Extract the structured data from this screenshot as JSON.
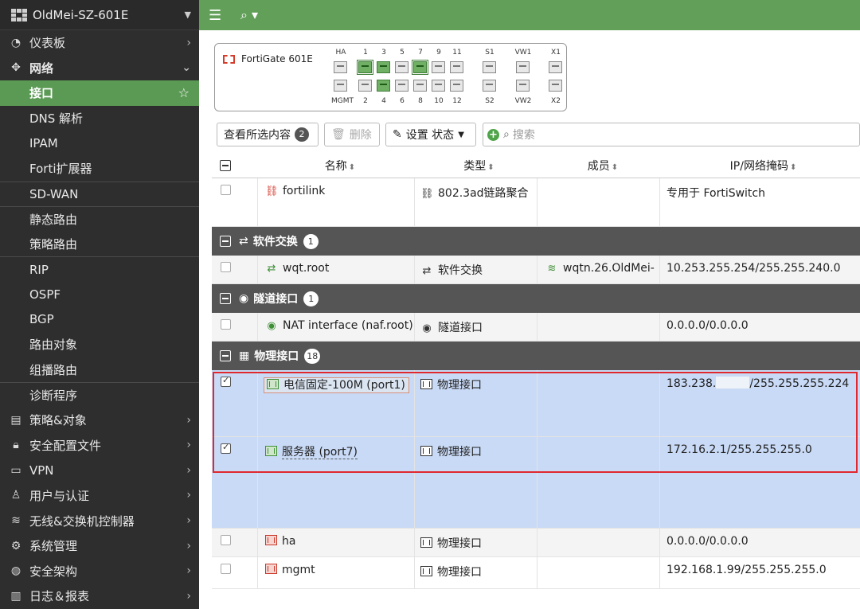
{
  "device_name": "OldMei-SZ-601E",
  "sidebar": {
    "items": [
      {
        "icon": "dashboard-icon",
        "glyph": "◔",
        "label": "仪表板",
        "chevron": "›"
      },
      {
        "icon": "network-icon",
        "glyph": "✥",
        "label": "网络",
        "chevron": "⌄"
      }
    ],
    "network_sub": [
      {
        "label": "接口"
      },
      {
        "label": "DNS 解析"
      },
      {
        "label": "IPAM"
      },
      {
        "label": "Forti扩展器"
      },
      {
        "label": "SD-WAN"
      },
      {
        "label": "静态路由"
      },
      {
        "label": "策略路由"
      },
      {
        "label": "RIP"
      },
      {
        "label": "OSPF"
      },
      {
        "label": "BGP"
      },
      {
        "label": "路由对象"
      },
      {
        "label": "组播路由"
      },
      {
        "label": "诊断程序"
      }
    ],
    "bottom_items": [
      {
        "icon": "policy-icon",
        "glyph": "▤",
        "label": "策略&对象"
      },
      {
        "icon": "lock-icon",
        "glyph": "🔒︎",
        "label": "安全配置文件"
      },
      {
        "icon": "laptop-icon",
        "glyph": "▭",
        "label": "VPN"
      },
      {
        "icon": "user-icon",
        "glyph": "♙",
        "label": "用户与认证"
      },
      {
        "icon": "wifi-icon",
        "glyph": "≋",
        "label": "无线&交换机控制器"
      },
      {
        "icon": "gear-icon",
        "glyph": "⚙",
        "label": "系统管理"
      },
      {
        "icon": "fabric-icon",
        "glyph": "◍",
        "label": "安全架构"
      },
      {
        "icon": "chart-icon",
        "glyph": "▥",
        "label": "日志＆报表"
      }
    ]
  },
  "topbar": {
    "menu_glyph": "☰",
    "search_glyph": "⌕ ▾"
  },
  "device_panel": {
    "model": "FortiGate 601E",
    "top_labels": [
      "HA",
      "1",
      "3",
      "5",
      "7",
      "9",
      "11",
      "S1",
      "VW1",
      "X1"
    ],
    "bottom_labels": [
      "MGMT",
      "2",
      "4",
      "6",
      "8",
      "10",
      "12",
      "S2",
      "VW2",
      "X2"
    ]
  },
  "toolbar": {
    "view_selected": "查看所选内容",
    "view_selected_count": "2",
    "delete": "删除",
    "set_status": "设置 状态",
    "search_placeholder": "搜索"
  },
  "columns": [
    "名称",
    "类型",
    "成员",
    "IP/网络掩码"
  ],
  "rows": {
    "fortilink": {
      "name": "fortilink",
      "type": "802.3ad链路聚合",
      "member": "",
      "ip": "专用于 FortiSwitch"
    },
    "wqt": {
      "name": "wqt.root",
      "type": "软件交换",
      "member": "wqtn.26.OldMei-",
      "ip": "10.253.255.254/255.255.240.0"
    },
    "naf": {
      "name": "NAT interface (naf.root)",
      "type": "隧道接口",
      "member": "",
      "ip": "0.0.0.0/0.0.0.0"
    },
    "port1": {
      "name": "电信固定-100M (port1)",
      "type": "物理接口",
      "member": "",
      "ip_prefix": "183.238.",
      "ip_suffix": "/255.255.255.224"
    },
    "port7": {
      "name": "服务器 (port7)",
      "type": "物理接口",
      "member": "",
      "ip": "172.16.2.1/255.255.255.0"
    },
    "ha": {
      "name": "ha",
      "type": "物理接口",
      "member": "",
      "ip": "0.0.0.0/0.0.0.0"
    },
    "mgmt": {
      "name": "mgmt",
      "type": "物理接口",
      "member": "",
      "ip": "192.168.1.99/255.255.255.0"
    }
  },
  "groups": {
    "software_switch": {
      "label": "软件交换",
      "count": "1"
    },
    "tunnel": {
      "label": "隧道接口",
      "count": "1"
    },
    "physical": {
      "label": "物理接口",
      "count": "18"
    }
  },
  "colors": {
    "accent_green": "#62a059",
    "selection_blue": "#c9daf6",
    "highlight_red": "#e0282e"
  }
}
